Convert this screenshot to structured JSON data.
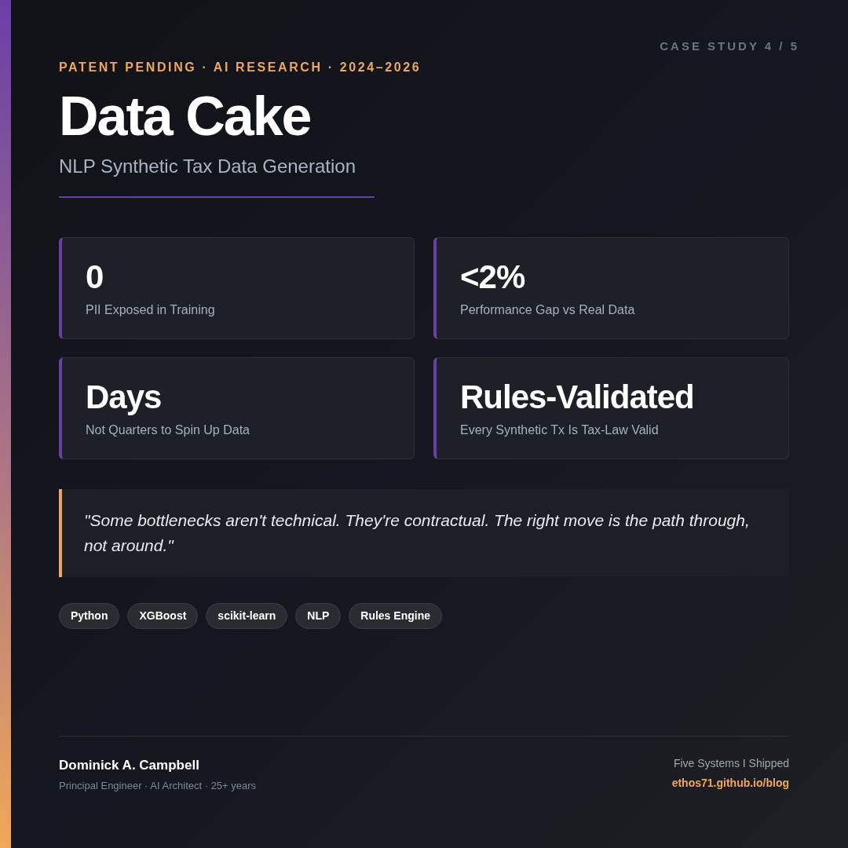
{
  "case_study": "CASE STUDY 4 / 5",
  "eyebrow": "PATENT PENDING · AI RESEARCH · 2024–2026",
  "title": "Data Cake",
  "subtitle": "NLP Synthetic Tax Data Generation",
  "stats": [
    {
      "value": "0",
      "label": "PII Exposed in Training"
    },
    {
      "value": "<2%",
      "label": "Performance Gap vs Real Data"
    },
    {
      "value": "Days",
      "label": "Not Quarters to Spin Up Data"
    },
    {
      "value": "Rules-Validated",
      "label": "Every Synthetic Tx Is Tax-Law Valid"
    }
  ],
  "quote": "\"Some bottlenecks aren't technical. They're contractual. The right move is the path through, not around.\"",
  "tags": [
    "Python",
    "XGBoost",
    "scikit-learn",
    "NLP",
    "Rules Engine"
  ],
  "footer": {
    "name": "Dominick A. Campbell",
    "role": "Principal Engineer · AI Architect · 25+ years",
    "tagline": "Five Systems I Shipped",
    "link": "ethos71.github.io/blog"
  }
}
